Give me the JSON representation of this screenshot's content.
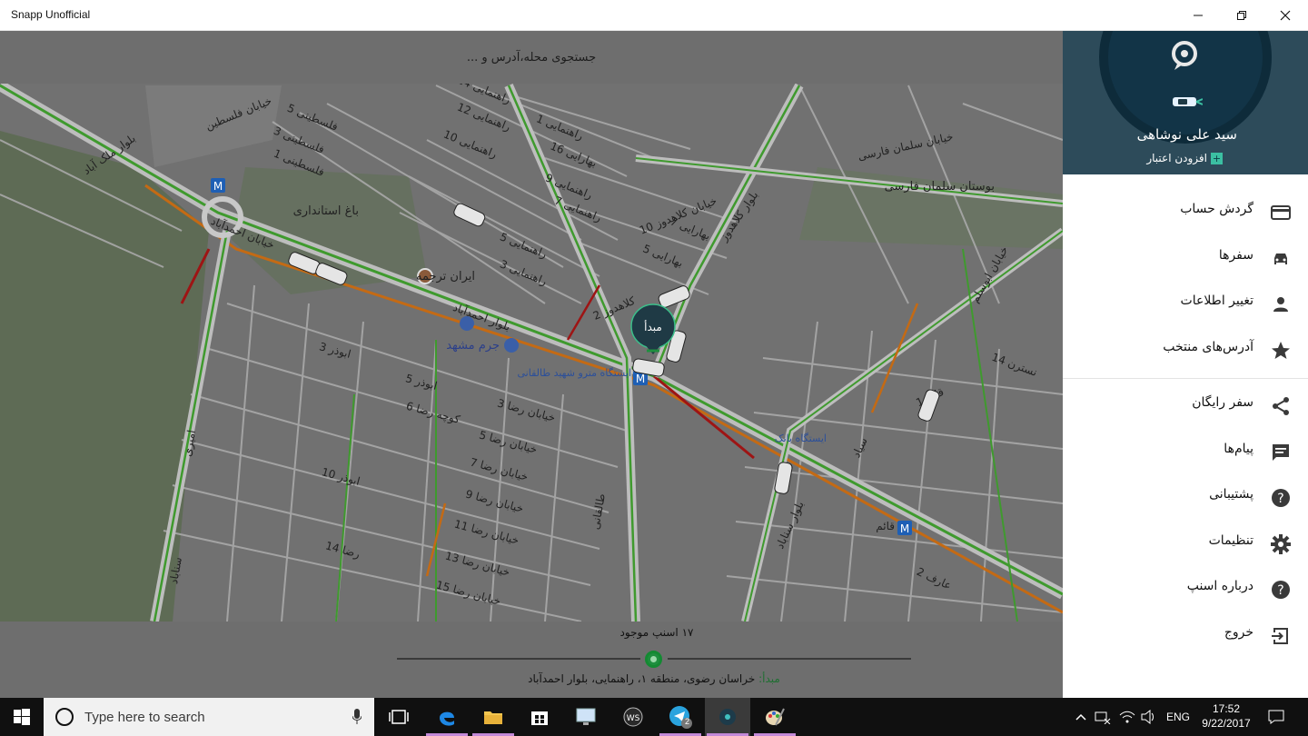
{
  "window": {
    "title": "Snapp Unofficial"
  },
  "search": {
    "placeholder": "جستجوی محله،آدرس و ..."
  },
  "map": {
    "pin_label": "مبدأ",
    "labels": [
      "باغ استانداری",
      "ایران ترجمه",
      "جرم مشهد",
      "ایستگاه مترو شهید طالقانی",
      "ایستگاه بانک",
      "بوستان سلمان فارسی",
      "خیابان سلمان فارسی",
      "بلوار احمدآباد",
      "خیابان احمدآباد",
      "راهنمایی 14",
      "راهنمایی 12",
      "راهنمایی 10",
      "راهنمایی 9",
      "راهنمایی 7",
      "راهنمایی 5",
      "راهنمایی 3",
      "راهنمایی 1",
      "بهارایی 16",
      "بهارایی 7",
      "بهارایی 5",
      "فلسطینی 5",
      "فلسطینی 3",
      "فلسطینی 1",
      "خیابان فلسطین",
      "ابوذر 3",
      "ابوذر 5",
      "ابوذر 10",
      "خیابان رضا 3",
      "خیابان رضا 5",
      "خیابان رضا 7",
      "خیابان رضا 9",
      "خیابان رضا 11",
      "خیابان رضا 13",
      "خیابان رضا 15",
      "رضا 14",
      "کوچه رضا 6",
      "بلوار کلاهدوز",
      "خیابان کلاهدوز 10",
      "کلاهدوز 2",
      "طالقانی",
      "خیابان ابوسلم",
      "قائم 1",
      "سیاد",
      "امیری",
      "سناباد",
      "بلوار سناباد",
      "قائم",
      "عارف 2",
      "بلوار ملک آباد",
      "نسترن 14"
    ],
    "metro_icon": "M"
  },
  "bottom": {
    "available_count": "۱۷ اسنپ موجود",
    "origin_prefix": "مبدأ:",
    "origin_address": "خراسان رضوی، منطقه ۱، راهنمایی، بلوار احمدآباد"
  },
  "drawer": {
    "user_name": "سید علی نوشاهی",
    "add_credit": "افزودن اعتبار",
    "items": [
      {
        "label": "گردش حساب",
        "icon": "credit-card-icon"
      },
      {
        "label": "سفرها",
        "icon": "car-icon"
      },
      {
        "label": "تغییر اطلاعات",
        "icon": "person-icon"
      },
      {
        "label": "آدرس‌های منتخب",
        "icon": "star-icon"
      },
      {
        "label": "سفر رایگان",
        "icon": "share-icon"
      },
      {
        "label": "پیام‌ها",
        "icon": "message-icon"
      },
      {
        "label": "پشتیبانی",
        "icon": "help-icon"
      },
      {
        "label": "تنظیمات",
        "icon": "gear-icon"
      },
      {
        "label": "درباره اسنپ",
        "icon": "help-icon"
      },
      {
        "label": "خروج",
        "icon": "exit-icon"
      }
    ]
  },
  "taskbar": {
    "search_placeholder": "Type here to search",
    "language": "ENG",
    "time": "17:52",
    "date": "9/22/2017",
    "badge": "2"
  },
  "colors": {
    "map_road": "#b4b4b4",
    "map_bg": "#6f6f6f",
    "traffic_green": "#3f9a2e",
    "traffic_orange": "#c46a14",
    "traffic_red": "#9e1414",
    "drawer_header": "#2d4b5a",
    "accent_green": "#1f8f3f"
  }
}
